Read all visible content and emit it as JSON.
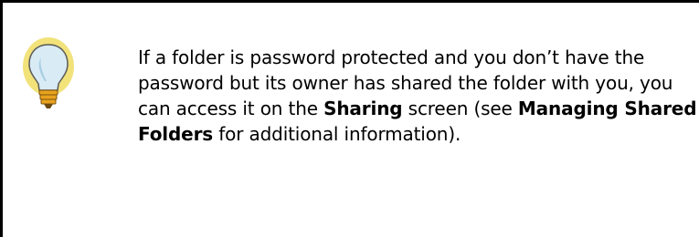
{
  "tip": {
    "icon": "lightbulb-icon",
    "text_before_sharing": "If a folder is password protected and you don’t have the password but its owner has shared the folder with you, you can access it on the ",
    "sharing_ref": "Sharing",
    "text_middle": " screen (see ",
    "managing_ref": "Managing Shared Folders",
    "text_after": " for additional information)."
  },
  "colors": {
    "border": "#000000",
    "bulb_glow": "#f2e27a",
    "bulb_glass": "#cfe6f2",
    "bulb_base": "#e8a21c"
  }
}
